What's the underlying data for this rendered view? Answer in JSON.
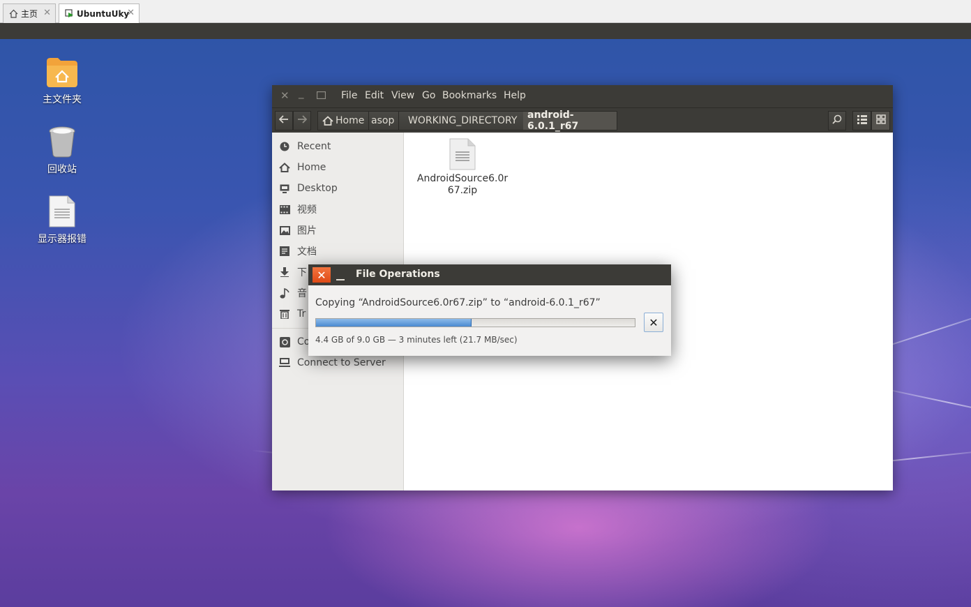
{
  "host_tabs": [
    {
      "label": "主页",
      "icon": "home-icon"
    },
    {
      "label": "UbuntuUky",
      "icon": "vm-icon"
    }
  ],
  "desktop_icons": [
    {
      "label": "主文件夹",
      "icon": "home-folder-icon"
    },
    {
      "label": "回收站",
      "icon": "trash-icon"
    },
    {
      "label": "显示器报错",
      "icon": "text-document-icon"
    }
  ],
  "nautilus": {
    "menu": [
      "File",
      "Edit",
      "View",
      "Go",
      "Bookmarks",
      "Help"
    ],
    "breadcrumbs": [
      "Home",
      "asop",
      "WORKING_DIRECTORY",
      "android-6.0.1_r67"
    ],
    "sidebar": [
      {
        "label": "Recent",
        "icon": "clock-icon"
      },
      {
        "label": "Home",
        "icon": "home-icon"
      },
      {
        "label": "Desktop",
        "icon": "desktop-icon"
      },
      {
        "label": "视频",
        "icon": "film-icon"
      },
      {
        "label": "图片",
        "icon": "picture-icon"
      },
      {
        "label": "文档",
        "icon": "document-icon"
      },
      {
        "label": "下",
        "icon": "download-icon"
      },
      {
        "label": "音",
        "icon": "music-icon"
      },
      {
        "label": "Tr",
        "icon": "trash-icon"
      },
      {
        "label": "Co",
        "icon": "computer-icon"
      },
      {
        "label": "Connect to Server",
        "icon": "network-server-icon"
      }
    ],
    "files": [
      {
        "name_line1": "AndroidSource6.0r",
        "name_line2": "67.zip",
        "icon": "zip-file-icon"
      }
    ]
  },
  "file_operations": {
    "title": "File Operations",
    "message": "Copying “AndroidSource6.0r67.zip” to “android-6.0.1_r67”",
    "progress_fraction": 0.4889,
    "status": "4.4 GB of 9.0 GB — 3 minutes left (21.7 MB/sec)",
    "cancel_symbol": "✕"
  },
  "colors": {
    "titlebar": "#3c3b37",
    "close_orange": "#df4a16",
    "progress_blue": "#4a8ad0"
  }
}
